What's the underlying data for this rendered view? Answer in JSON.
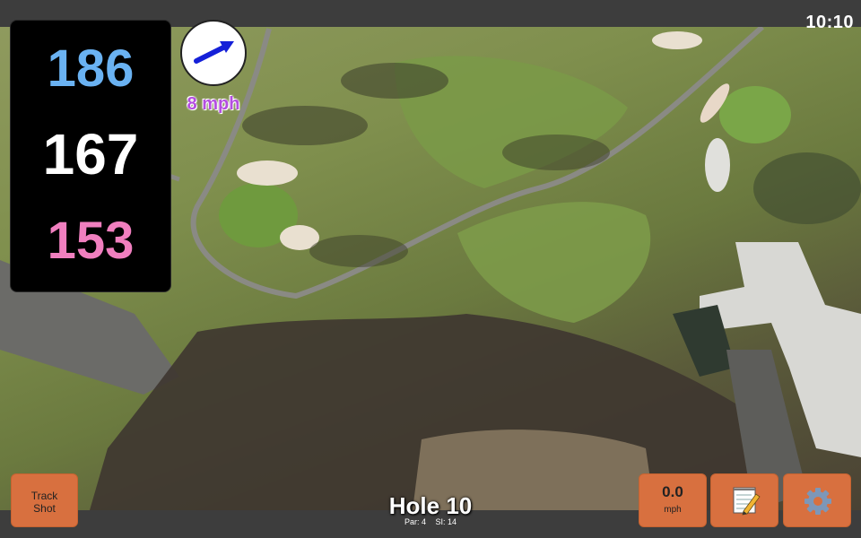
{
  "status": {
    "clock": "10:10"
  },
  "distances": {
    "back": "186",
    "middle": "167",
    "front": "153"
  },
  "wind": {
    "speed_label": "8 mph",
    "direction_icon": "arrow-right-icon"
  },
  "hole": {
    "title": "Hole 10",
    "par": "Par: 4",
    "stroke_index": "SI: 14"
  },
  "controls": {
    "track_shot_line1": "Track",
    "track_shot_line2": "Shot",
    "speed_value": "0.0",
    "speed_unit": "mph",
    "notes_icon": "notepad-icon",
    "settings_icon": "gear-icon"
  },
  "colors": {
    "back_distance": "#6ab2f2",
    "middle_distance": "#ffffff",
    "front_distance": "#f07fbf",
    "wind_label": "#b44ee0",
    "button": "#d8703f"
  }
}
